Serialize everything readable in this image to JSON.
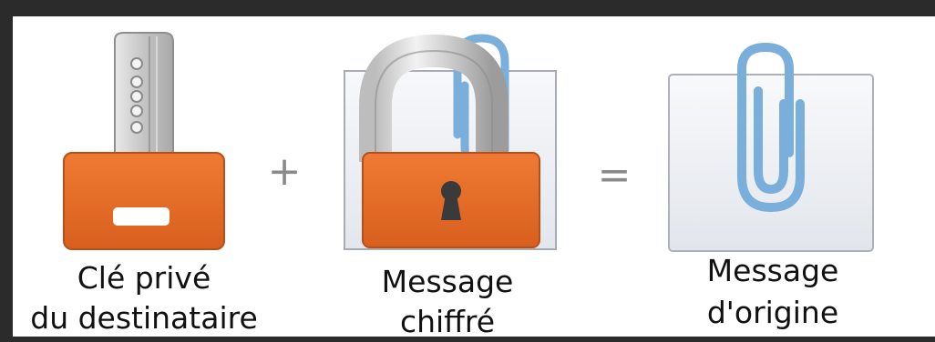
{
  "items": {
    "private_key": {
      "icon": "private-key-icon",
      "label_line1": "Clé privé",
      "label_line2": "du destinataire"
    },
    "encrypted_message": {
      "icon": "locked-message-icon",
      "label_line1": "Message",
      "label_line2": "chiffré"
    },
    "original_message": {
      "icon": "paperclip-message-icon",
      "label_line1": "Message",
      "label_line2": "d'origine"
    }
  },
  "operators": {
    "plus": "+",
    "equals": "="
  },
  "colors": {
    "lock_orange": "#ea6f2a",
    "paperclip_blue": "#7aaedb",
    "metal_silver": "#cfcfcf",
    "frame": "#2b2b2b",
    "background": "#ffffff"
  }
}
